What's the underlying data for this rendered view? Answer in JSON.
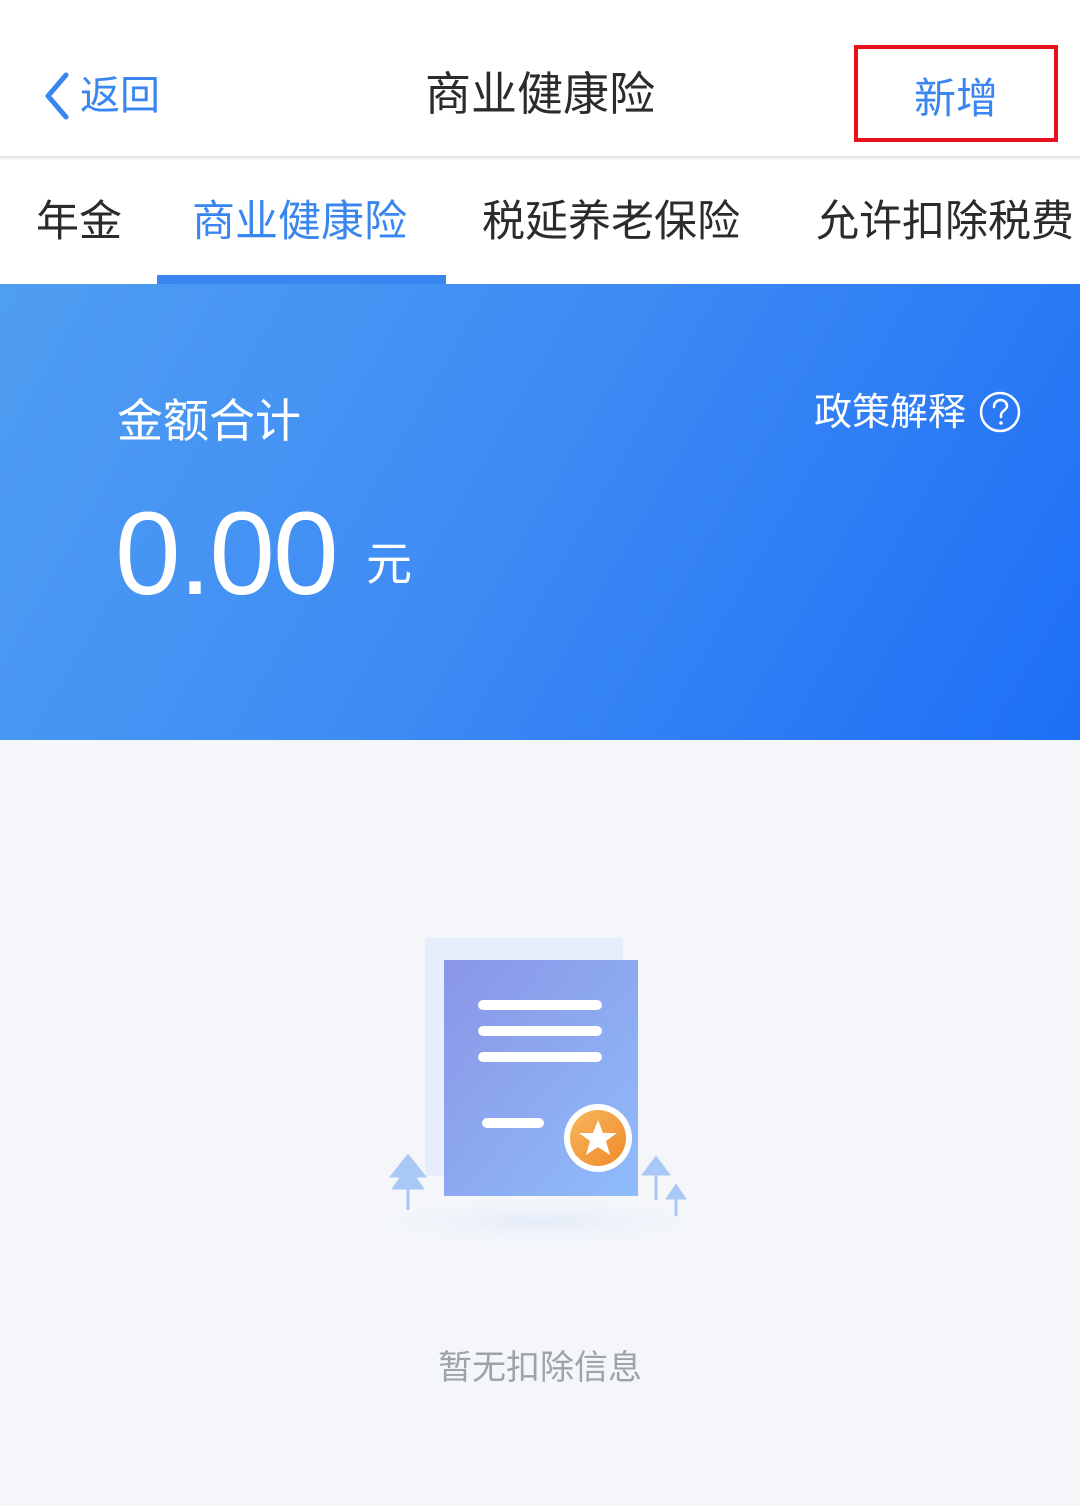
{
  "nav": {
    "back_label": "返回",
    "title": "商业健康险",
    "add_label": "新增"
  },
  "tabs": [
    {
      "label": "年金"
    },
    {
      "label": "商业健康险",
      "active": true
    },
    {
      "label": "税延养老保险"
    },
    {
      "label": "允许扣除税费"
    }
  ],
  "summary": {
    "label": "金额合计",
    "amount": "0.00",
    "unit": "元",
    "policy_label": "政策解释",
    "policy_icon": "question-circle-icon"
  },
  "empty": {
    "message": "暂无扣除信息",
    "illustration": "document-star-icon"
  },
  "colors": {
    "accent": "#3a86f0",
    "highlight_box": "#e8101c",
    "summary_gradient_start": "#4f9ef2",
    "summary_gradient_end": "#1d6ff6",
    "empty_text": "#9ea3aa"
  }
}
